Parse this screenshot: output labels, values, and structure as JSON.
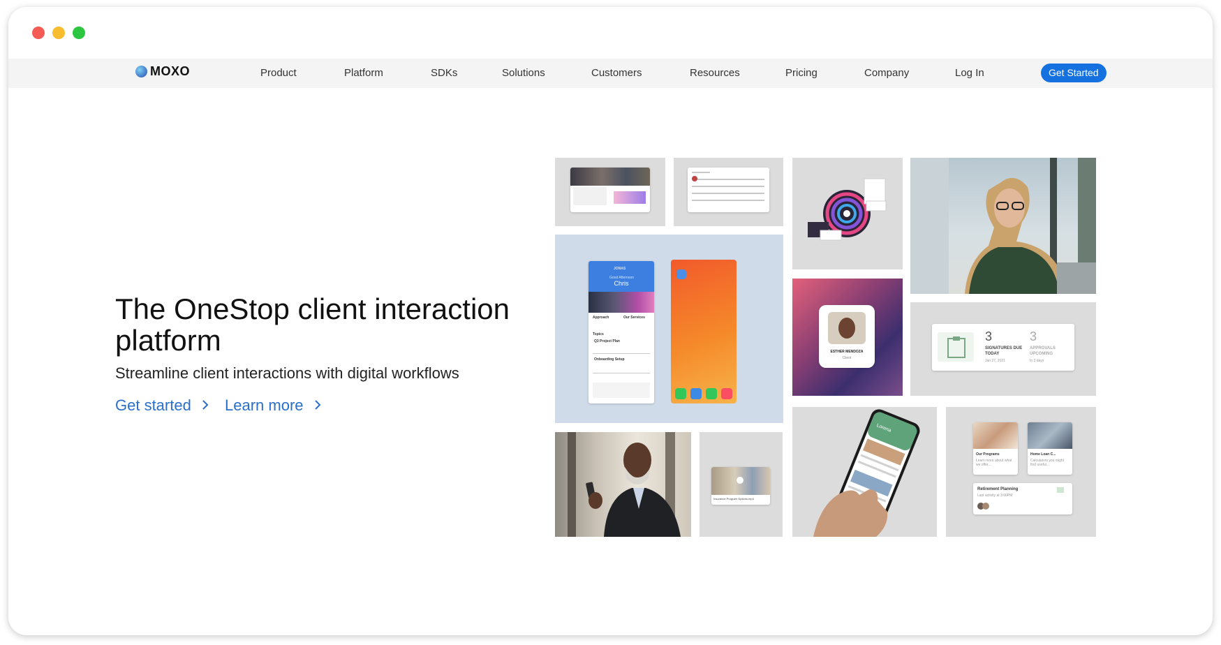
{
  "brand": {
    "name": "MOXO"
  },
  "nav": {
    "items": [
      "Product",
      "Platform",
      "SDKs",
      "Solutions",
      "Customers",
      "Resources",
      "Pricing",
      "Company",
      "Log In"
    ],
    "cta": "Get Started"
  },
  "hero": {
    "title": "The OneStop client interaction platform",
    "subtitle": "Streamline client interactions with digital workflows",
    "primary_link": "Get started",
    "secondary_link": "Learn more"
  },
  "collage": {
    "phone_app": {
      "brand": "JONAS",
      "greeting": "Good Afternoon",
      "name": "Chris",
      "card1": "Approach",
      "card2": "Our Services",
      "section": "Topics",
      "item1": "Q3 Project Plan",
      "item2": "Onboarding Setup"
    },
    "profile": {
      "name": "ESTHER MENDOZA",
      "role": "Client"
    },
    "signatures": {
      "count_due": "3",
      "label_due": "SIGNATURES DUE TODAY",
      "date": "Jan 27, 2021",
      "count_approvals": "3",
      "label_approvals": "APPROVALS UPCOMING",
      "approvals_note": "In 3 days"
    },
    "video_caption": "Insurance Program Options.mp4",
    "phone2_name": "Lorena",
    "programs": {
      "card1_title": "Our Programs",
      "card1_text": "Learn more about what we offer...",
      "card2_title": "Home Loan C...",
      "card2_text": "Calculators you might find useful...",
      "retirement_title": "Retirement Planning",
      "retirement_text": "Last activity at 3:00PM"
    }
  },
  "colors": {
    "accent": "#1570e0",
    "link": "#2a6fcb",
    "tile_gray": "#dcdcdc",
    "tile_blue": "#cfdbe8"
  }
}
